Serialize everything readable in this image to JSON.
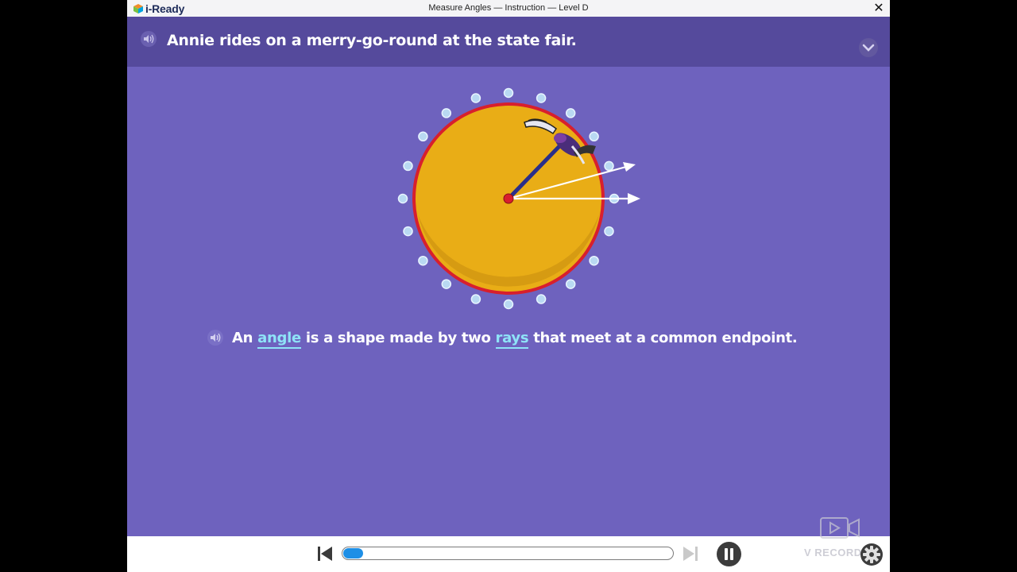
{
  "window": {
    "logo_text": "i-Ready",
    "title": "Measure Angles — Instruction — Level D",
    "close_glyph": "✕"
  },
  "banner": {
    "text": "Annie rides on a merry-go-round at the state fair.",
    "audio_icon": "speaker-icon",
    "collapse_icon": "chevron-down-icon"
  },
  "caption": {
    "pre": "An ",
    "term1": "angle",
    "mid": " is a shape made by two ",
    "term2": "rays",
    "post": " that meet at a common endpoint."
  },
  "player": {
    "progress": 0.06,
    "prev_icon": "skip-back-icon",
    "next_icon": "skip-forward-icon",
    "pause_icon": "pause-icon"
  },
  "overlay": {
    "watermark": "V RECORDER"
  },
  "colors": {
    "background": "#6e62be",
    "banner": "#554a9c",
    "vocab": "#8ee3f7",
    "disc": "#e9ad16",
    "rim": "#d81f2d",
    "progress": "#1e8fe6"
  }
}
